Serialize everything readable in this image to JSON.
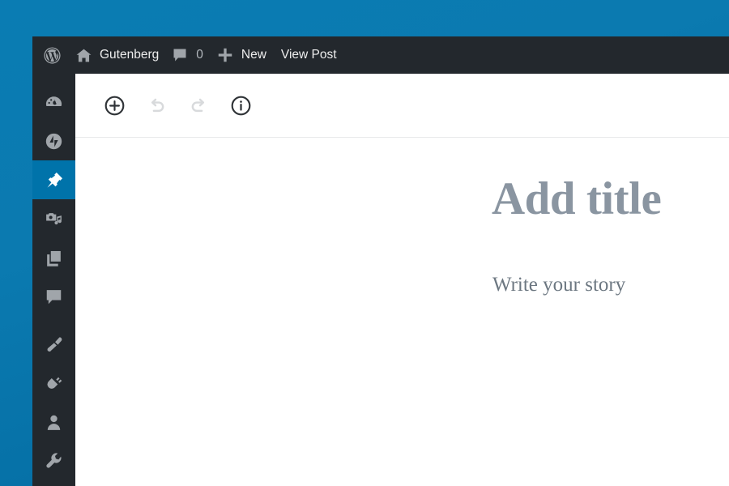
{
  "theme": {
    "desktop_bg_top": "#0a7cb3",
    "desktop_bg_bottom": "#00679d",
    "admin_bar_bg": "#23282d",
    "menu_bg": "#23282d",
    "menu_icon": "#a0a5aa",
    "accent_blue": "#0073aa",
    "editor_bg": "#ffffff",
    "title_color": "#8a95a1",
    "body_color": "#6c7781"
  },
  "admin_bar": {
    "logo": {
      "icon": "wordpress-logo-icon",
      "label": ""
    },
    "site": {
      "icon": "home-icon",
      "label": "Gutenberg"
    },
    "comments": {
      "icon": "comment-bubble-icon",
      "count": "0"
    },
    "new": {
      "icon": "plus-icon",
      "label": "New"
    },
    "view_post": {
      "label": "View Post"
    }
  },
  "admin_menu": {
    "items": [
      {
        "name": "dashboard",
        "icon": "dashboard-gauge-icon",
        "label": "Dashboard",
        "current": false
      },
      {
        "name": "jetpack",
        "icon": "jetpack-icon",
        "label": "Jetpack",
        "current": false
      },
      {
        "name": "posts",
        "icon": "pin-icon",
        "label": "Posts",
        "current": true
      },
      {
        "name": "media",
        "icon": "media-camera-music-icon",
        "label": "Media",
        "current": false
      },
      {
        "name": "pages",
        "icon": "pages-stack-icon",
        "label": "Pages",
        "current": false
      },
      {
        "name": "comments",
        "icon": "comment-bubble-icon",
        "label": "Comments",
        "current": false
      },
      {
        "name": "appearance",
        "icon": "paintbrush-icon",
        "label": "Appearance",
        "current": false
      },
      {
        "name": "plugins",
        "icon": "plug-icon",
        "label": "Plugins",
        "current": false
      },
      {
        "name": "users",
        "icon": "user-icon",
        "label": "Users",
        "current": false
      },
      {
        "name": "tools",
        "icon": "wrench-icon",
        "label": "Tools",
        "current": false
      }
    ]
  },
  "editor": {
    "toolbar": [
      {
        "name": "add-block",
        "icon": "plus-circle-icon",
        "label": "Add block",
        "enabled": true
      },
      {
        "name": "undo",
        "icon": "undo-arrow-icon",
        "label": "Undo",
        "enabled": false
      },
      {
        "name": "redo",
        "icon": "redo-arrow-icon",
        "label": "Redo",
        "enabled": false
      },
      {
        "name": "content-info",
        "icon": "info-circle-icon",
        "label": "Content structure",
        "enabled": true
      }
    ],
    "title_placeholder": "Add title",
    "body_placeholder": "Write your story"
  }
}
